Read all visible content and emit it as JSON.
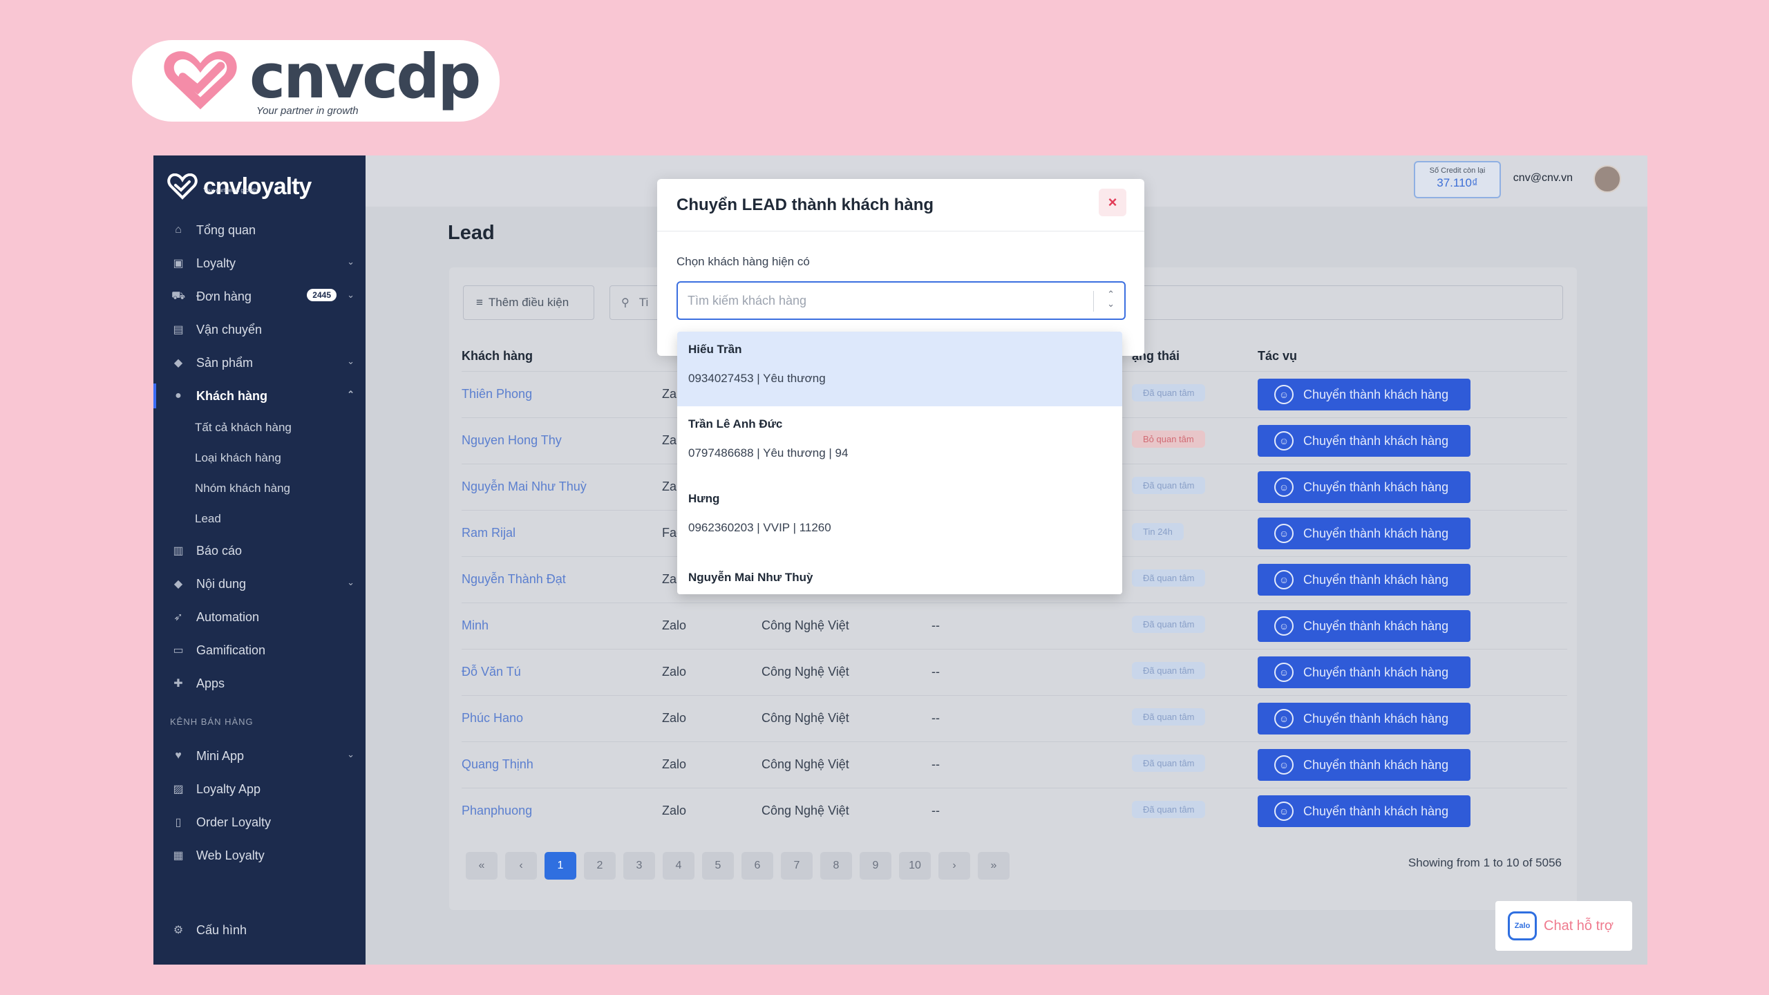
{
  "brand": {
    "name": "cnvcdp",
    "tagline": "Your partner in growth",
    "accent": "#f48ca8"
  },
  "sidebar": {
    "logo": "cnvloyalty",
    "logo_sub": "Your partner in growth",
    "items": [
      {
        "label": "Tổng quan",
        "icon": "home-icon"
      },
      {
        "label": "Loyalty",
        "icon": "gift-icon",
        "chevron": "⌄"
      },
      {
        "label": "Đơn hàng",
        "icon": "cart-icon",
        "badge": "2445",
        "chevron": "⌄"
      },
      {
        "label": "Vận chuyển",
        "icon": "truck-icon"
      },
      {
        "label": "Sản phẩm",
        "icon": "tag-icon",
        "chevron": "⌄"
      },
      {
        "label": "Khách hàng",
        "icon": "user-icon",
        "chevron": "⌃"
      }
    ],
    "customer_sub": [
      "Tất cả khách hàng",
      "Loại khách hàng",
      "Nhóm khách hàng",
      "Lead"
    ],
    "items2": [
      {
        "label": "Báo cáo",
        "icon": "bar-chart-icon"
      },
      {
        "label": "Nội dung",
        "icon": "tag-icon",
        "chevron": "⌄"
      },
      {
        "label": "Automation",
        "icon": "rocket-icon"
      },
      {
        "label": "Gamification",
        "icon": "gamepad-icon"
      },
      {
        "label": "Apps",
        "icon": "puzzle-icon"
      }
    ],
    "section": "KÊNH BÁN HÀNG",
    "items3": [
      {
        "label": "Mini App",
        "icon": "heart-icon",
        "chevron": "⌄"
      },
      {
        "label": "Loyalty App",
        "icon": "image-icon"
      },
      {
        "label": "Order Loyalty",
        "icon": "clipboard-icon"
      },
      {
        "label": "Web Loyalty",
        "icon": "grid-icon"
      }
    ],
    "settings": "Cấu hình"
  },
  "topbar": {
    "credit_label": "Số Credit còn lại",
    "credit_value": "37.110₫",
    "user": "cnv@cnv.vn"
  },
  "page": {
    "title": "Lead"
  },
  "filters": {
    "add_condition": "Thêm điều kiện",
    "search_placeholder": "Ti"
  },
  "table": {
    "headers": [
      "Khách hàng",
      "ạng thái",
      "Tác vụ"
    ],
    "action_label": "Chuyển thành khách hàng",
    "rows": [
      {
        "name": "Thiên Phong",
        "source": "Zal",
        "company": "",
        "dash": "",
        "status": "Đã quan tâm",
        "red": false
      },
      {
        "name": "Nguyen Hong Thy",
        "source": "Zal",
        "company": "",
        "dash": "",
        "status": "Bỏ quan tâm",
        "red": true
      },
      {
        "name": "Nguyễn Mai Như Thuỳ",
        "source": "Zal",
        "company": "",
        "dash": "",
        "status": "Đã quan tâm",
        "red": false
      },
      {
        "name": "Ram Rijal",
        "source": "Fac",
        "company": "",
        "dash": "",
        "status": "Tin 24h",
        "red": false
      },
      {
        "name": "Nguyễn Thành Đạt",
        "source": "Zal",
        "company": "",
        "dash": "",
        "status": "Đã quan tâm",
        "red": false
      },
      {
        "name": "Minh",
        "source": "Zalo",
        "company": "Công Nghệ Việt",
        "dash": "--",
        "status": "Đã quan tâm",
        "red": false
      },
      {
        "name": "Đỗ Văn Tú",
        "source": "Zalo",
        "company": "Công Nghệ Việt",
        "dash": "--",
        "status": "Đã quan tâm",
        "red": false
      },
      {
        "name": "Phúc Hano",
        "source": "Zalo",
        "company": "Công Nghệ Việt",
        "dash": "--",
        "status": "Đã quan tâm",
        "red": false
      },
      {
        "name": "Quang Thịnh",
        "source": "Zalo",
        "company": "Công Nghệ Việt",
        "dash": "--",
        "status": "Đã quan tâm",
        "red": false
      },
      {
        "name": "Phanphuong",
        "source": "Zalo",
        "company": "Công Nghệ Việt",
        "dash": "--",
        "status": "Đã quan tâm",
        "red": false
      }
    ]
  },
  "pagination": {
    "pages": [
      "«",
      "‹",
      "1",
      "2",
      "3",
      "4",
      "5",
      "6",
      "7",
      "8",
      "9",
      "10",
      "›",
      "»"
    ],
    "active": "1",
    "showing": "Showing from 1 to 10 of 5056"
  },
  "chat": {
    "label": "Chat hỗ trợ",
    "icon_text": "Zalo"
  },
  "modal": {
    "title": "Chuyển LEAD thành khách hàng",
    "close": "×",
    "field_label": "Chọn khách hàng hiện có",
    "placeholder": "Tìm kiếm khách hàng",
    "options": [
      {
        "name": "Hiếu Trần",
        "meta": "0934027453 | Yêu thương"
      },
      {
        "name": "Trần Lê Anh Đức",
        "meta": "0797486688 | Yêu thương | 94"
      },
      {
        "name": "Hưng",
        "meta": "0962360203 | VVIP | 11260"
      },
      {
        "name": "Nguyễn Mai Như Thuỳ",
        "meta": ""
      }
    ]
  }
}
